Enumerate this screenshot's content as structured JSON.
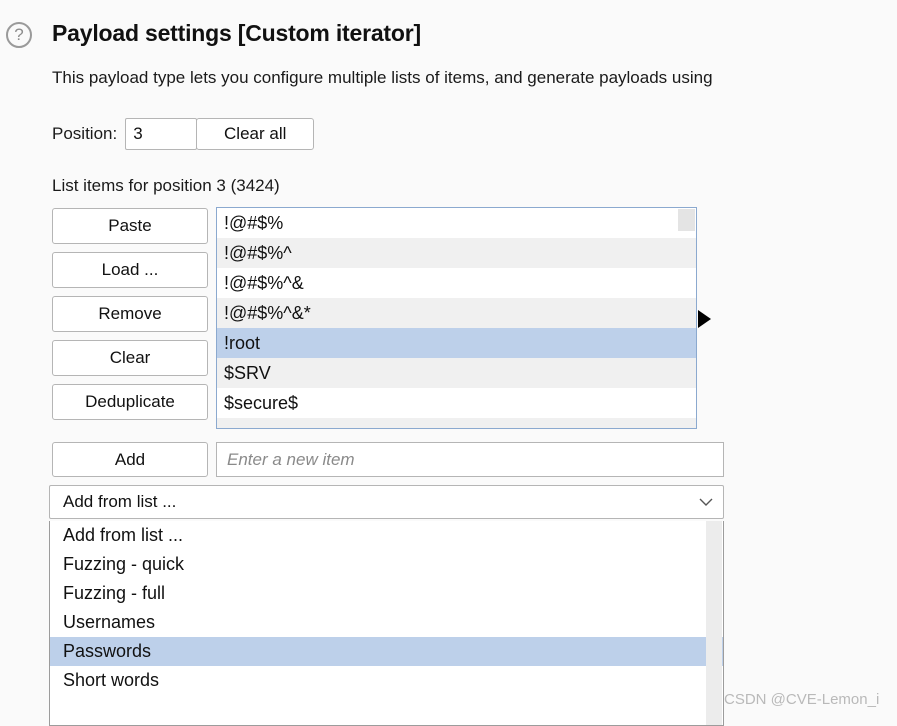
{
  "header": {
    "help_icon": "question-mark-icon",
    "title": "Payload settings [Custom iterator]",
    "description": "This payload type lets you configure multiple lists of items, and generate payloads using"
  },
  "position": {
    "label": "Position:",
    "value": "3",
    "clear_all_label": "Clear all"
  },
  "list_section": {
    "label": "List items for position 3 (3424)",
    "buttons": [
      {
        "label": "Paste"
      },
      {
        "label": "Load ..."
      },
      {
        "label": "Remove"
      },
      {
        "label": "Clear"
      },
      {
        "label": "Deduplicate"
      }
    ],
    "items": [
      {
        "text": "!@#$%",
        "selected": false
      },
      {
        "text": "!@#$%^",
        "selected": false
      },
      {
        "text": "!@#$%^&",
        "selected": false
      },
      {
        "text": "!@#$%^&*",
        "selected": false
      },
      {
        "text": "!root",
        "selected": true
      },
      {
        "text": "$SRV",
        "selected": false
      },
      {
        "text": "$secure$",
        "selected": false
      },
      {
        "text": "",
        "selected": false
      }
    ]
  },
  "add_row": {
    "add_label": "Add",
    "new_item_placeholder": "Enter a new item",
    "new_item_value": ""
  },
  "combo": {
    "selected": "Add from list ...",
    "chevron_icon": "chevron-down-icon",
    "options": [
      {
        "label": "Add from list ...",
        "selected": false
      },
      {
        "label": "Fuzzing - quick",
        "selected": false
      },
      {
        "label": "Fuzzing - full",
        "selected": false
      },
      {
        "label": "Usernames",
        "selected": false
      },
      {
        "label": "Passwords",
        "selected": true
      },
      {
        "label": "Short words",
        "selected": false
      }
    ]
  },
  "watermark": {
    "text": "CSDN @CVE-Lemon_i"
  },
  "colors": {
    "selection": "#bdd0ea",
    "alt_row": "#f0f0f0",
    "listbox_border": "#8ba9cf",
    "background": "#fafafa"
  }
}
